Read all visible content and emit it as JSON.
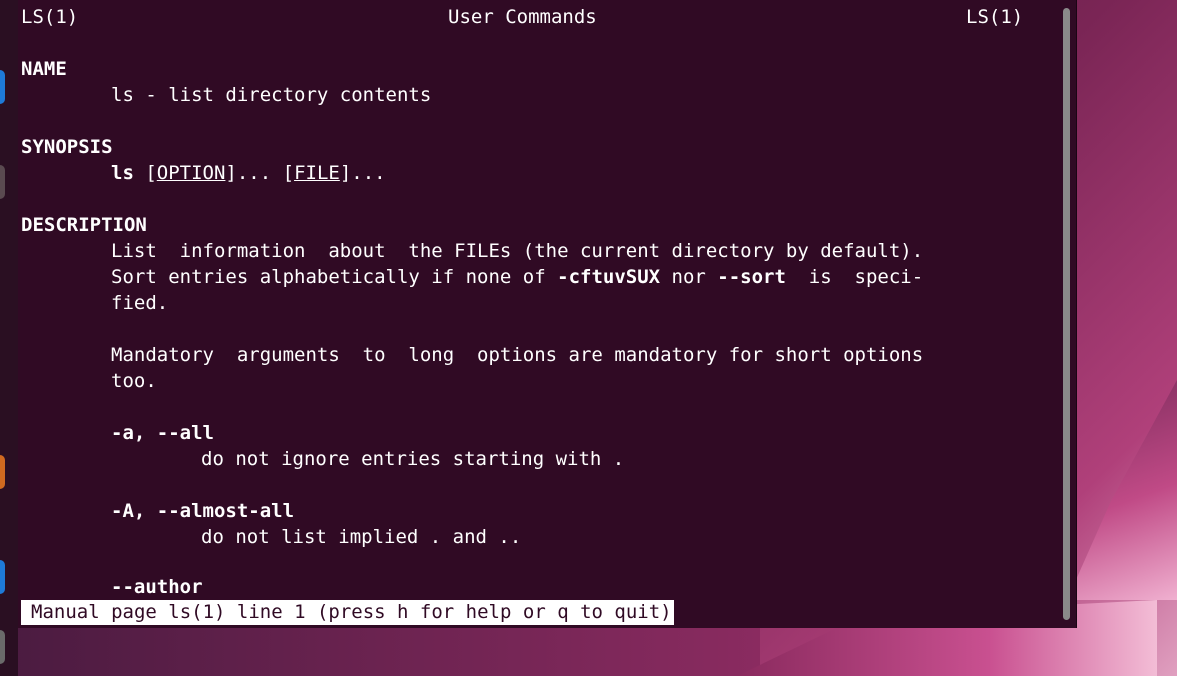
{
  "header": {
    "left": "LS(1)",
    "center": "User Commands",
    "right": "LS(1)"
  },
  "sections": {
    "name_title": "NAME",
    "name_text": "ls - list directory contents",
    "synopsis_title": "SYNOPSIS",
    "synopsis_cmd": "ls",
    "synopsis_opt": "OPTION",
    "synopsis_file": "FILE",
    "description_title": "DESCRIPTION"
  },
  "description": {
    "line1": "List  information  about  the FILEs (the current directory by default).",
    "line2_a": "Sort entries alphabetically if none of ",
    "line2_b": "-cftuvSUX",
    "line2_c": " nor ",
    "line2_d": "--sort",
    "line2_e": "  is  speci-",
    "line3": "fied.",
    "line4": "Mandatory  arguments  to  long  options are mandatory for short options",
    "line5": "too."
  },
  "options": [
    {
      "flag": "-a, --all",
      "desc": "do not ignore entries starting with ."
    },
    {
      "flag_a": "-A, ",
      "flag_b": "--almost-all",
      "desc": "do not list implied . and .."
    },
    {
      "flag": "--author"
    }
  ],
  "status_bar": "Manual page ls(1) line 1 (press h for help or q to quit)"
}
